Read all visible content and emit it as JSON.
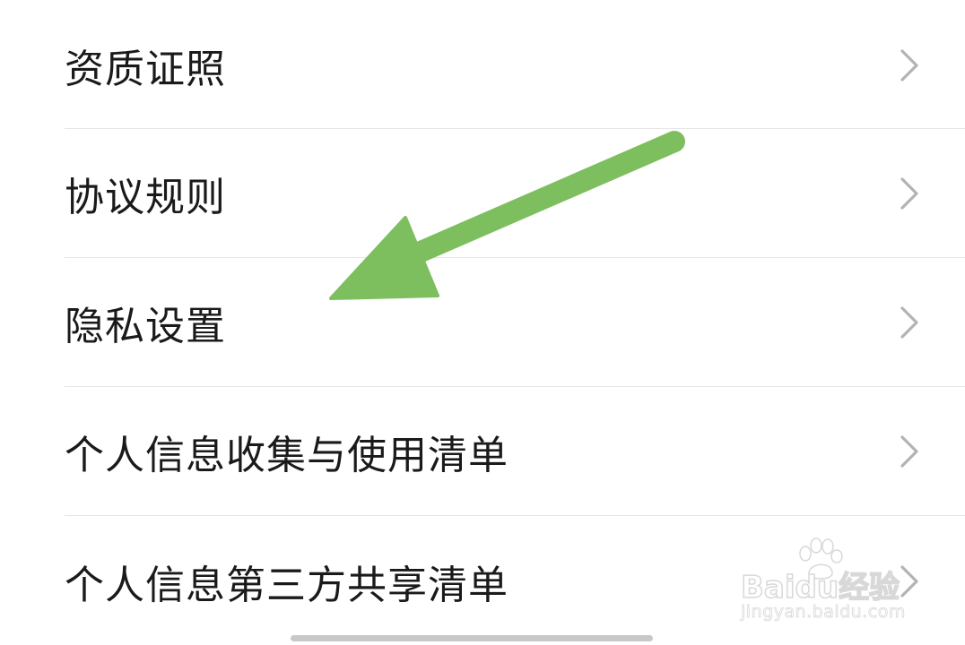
{
  "menu": {
    "items": [
      {
        "label": "资质证照",
        "icon": "chevron-right-icon"
      },
      {
        "label": "协议规则",
        "icon": "chevron-right-icon"
      },
      {
        "label": "隐私设置",
        "icon": "chevron-right-icon"
      },
      {
        "label": "个人信息收集与使用清单",
        "icon": "chevron-right-icon"
      },
      {
        "label": "个人信息第三方共享清单",
        "icon": "chevron-right-icon"
      }
    ]
  },
  "annotation": {
    "arrow_color": "#7dbf5e",
    "points_to": "隐私设置"
  },
  "watermark": {
    "brand": "Baidu",
    "suffix": "经验",
    "domain": "jingyan.baidu.com"
  },
  "colors": {
    "text": "#1a1a1a",
    "chevron": "#b3b3b3",
    "divider": "#e6e6e6",
    "background": "#ffffff"
  }
}
